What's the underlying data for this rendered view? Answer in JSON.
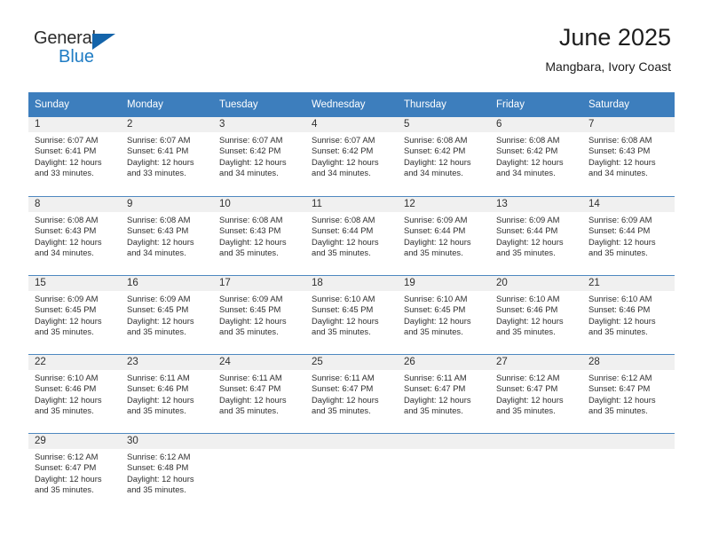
{
  "brand": {
    "name_top": "General",
    "name_bottom": "Blue",
    "triangle_icon": "blue-triangle-logo-mark",
    "colors": {
      "general_text": "#2b2b2b",
      "blue_text": "#1f7cc4",
      "triangle": "#1464aa"
    }
  },
  "header": {
    "title": "June 2025",
    "subtitle": "Mangbara, Ivory Coast"
  },
  "theme": {
    "header_row_bg": "#3d7ebd",
    "header_row_text": "#ffffff",
    "row_rule": "#4e88c0",
    "daynum_strip_bg": "#f0f0f0",
    "body_text": "#2f2f2f"
  },
  "calendar": {
    "weekday_headers": [
      "Sunday",
      "Monday",
      "Tuesday",
      "Wednesday",
      "Thursday",
      "Friday",
      "Saturday"
    ],
    "weeks": [
      [
        {
          "day": "1",
          "sunrise": "Sunrise: 6:07 AM",
          "sunset": "Sunset: 6:41 PM",
          "daylight_line1": "Daylight: 12 hours",
          "daylight_line2": "and 33 minutes."
        },
        {
          "day": "2",
          "sunrise": "Sunrise: 6:07 AM",
          "sunset": "Sunset: 6:41 PM",
          "daylight_line1": "Daylight: 12 hours",
          "daylight_line2": "and 33 minutes."
        },
        {
          "day": "3",
          "sunrise": "Sunrise: 6:07 AM",
          "sunset": "Sunset: 6:42 PM",
          "daylight_line1": "Daylight: 12 hours",
          "daylight_line2": "and 34 minutes."
        },
        {
          "day": "4",
          "sunrise": "Sunrise: 6:07 AM",
          "sunset": "Sunset: 6:42 PM",
          "daylight_line1": "Daylight: 12 hours",
          "daylight_line2": "and 34 minutes."
        },
        {
          "day": "5",
          "sunrise": "Sunrise: 6:08 AM",
          "sunset": "Sunset: 6:42 PM",
          "daylight_line1": "Daylight: 12 hours",
          "daylight_line2": "and 34 minutes."
        },
        {
          "day": "6",
          "sunrise": "Sunrise: 6:08 AM",
          "sunset": "Sunset: 6:42 PM",
          "daylight_line1": "Daylight: 12 hours",
          "daylight_line2": "and 34 minutes."
        },
        {
          "day": "7",
          "sunrise": "Sunrise: 6:08 AM",
          "sunset": "Sunset: 6:43 PM",
          "daylight_line1": "Daylight: 12 hours",
          "daylight_line2": "and 34 minutes."
        }
      ],
      [
        {
          "day": "8",
          "sunrise": "Sunrise: 6:08 AM",
          "sunset": "Sunset: 6:43 PM",
          "daylight_line1": "Daylight: 12 hours",
          "daylight_line2": "and 34 minutes."
        },
        {
          "day": "9",
          "sunrise": "Sunrise: 6:08 AM",
          "sunset": "Sunset: 6:43 PM",
          "daylight_line1": "Daylight: 12 hours",
          "daylight_line2": "and 34 minutes."
        },
        {
          "day": "10",
          "sunrise": "Sunrise: 6:08 AM",
          "sunset": "Sunset: 6:43 PM",
          "daylight_line1": "Daylight: 12 hours",
          "daylight_line2": "and 35 minutes."
        },
        {
          "day": "11",
          "sunrise": "Sunrise: 6:08 AM",
          "sunset": "Sunset: 6:44 PM",
          "daylight_line1": "Daylight: 12 hours",
          "daylight_line2": "and 35 minutes."
        },
        {
          "day": "12",
          "sunrise": "Sunrise: 6:09 AM",
          "sunset": "Sunset: 6:44 PM",
          "daylight_line1": "Daylight: 12 hours",
          "daylight_line2": "and 35 minutes."
        },
        {
          "day": "13",
          "sunrise": "Sunrise: 6:09 AM",
          "sunset": "Sunset: 6:44 PM",
          "daylight_line1": "Daylight: 12 hours",
          "daylight_line2": "and 35 minutes."
        },
        {
          "day": "14",
          "sunrise": "Sunrise: 6:09 AM",
          "sunset": "Sunset: 6:44 PM",
          "daylight_line1": "Daylight: 12 hours",
          "daylight_line2": "and 35 minutes."
        }
      ],
      [
        {
          "day": "15",
          "sunrise": "Sunrise: 6:09 AM",
          "sunset": "Sunset: 6:45 PM",
          "daylight_line1": "Daylight: 12 hours",
          "daylight_line2": "and 35 minutes."
        },
        {
          "day": "16",
          "sunrise": "Sunrise: 6:09 AM",
          "sunset": "Sunset: 6:45 PM",
          "daylight_line1": "Daylight: 12 hours",
          "daylight_line2": "and 35 minutes."
        },
        {
          "day": "17",
          "sunrise": "Sunrise: 6:09 AM",
          "sunset": "Sunset: 6:45 PM",
          "daylight_line1": "Daylight: 12 hours",
          "daylight_line2": "and 35 minutes."
        },
        {
          "day": "18",
          "sunrise": "Sunrise: 6:10 AM",
          "sunset": "Sunset: 6:45 PM",
          "daylight_line1": "Daylight: 12 hours",
          "daylight_line2": "and 35 minutes."
        },
        {
          "day": "19",
          "sunrise": "Sunrise: 6:10 AM",
          "sunset": "Sunset: 6:45 PM",
          "daylight_line1": "Daylight: 12 hours",
          "daylight_line2": "and 35 minutes."
        },
        {
          "day": "20",
          "sunrise": "Sunrise: 6:10 AM",
          "sunset": "Sunset: 6:46 PM",
          "daylight_line1": "Daylight: 12 hours",
          "daylight_line2": "and 35 minutes."
        },
        {
          "day": "21",
          "sunrise": "Sunrise: 6:10 AM",
          "sunset": "Sunset: 6:46 PM",
          "daylight_line1": "Daylight: 12 hours",
          "daylight_line2": "and 35 minutes."
        }
      ],
      [
        {
          "day": "22",
          "sunrise": "Sunrise: 6:10 AM",
          "sunset": "Sunset: 6:46 PM",
          "daylight_line1": "Daylight: 12 hours",
          "daylight_line2": "and 35 minutes."
        },
        {
          "day": "23",
          "sunrise": "Sunrise: 6:11 AM",
          "sunset": "Sunset: 6:46 PM",
          "daylight_line1": "Daylight: 12 hours",
          "daylight_line2": "and 35 minutes."
        },
        {
          "day": "24",
          "sunrise": "Sunrise: 6:11 AM",
          "sunset": "Sunset: 6:47 PM",
          "daylight_line1": "Daylight: 12 hours",
          "daylight_line2": "and 35 minutes."
        },
        {
          "day": "25",
          "sunrise": "Sunrise: 6:11 AM",
          "sunset": "Sunset: 6:47 PM",
          "daylight_line1": "Daylight: 12 hours",
          "daylight_line2": "and 35 minutes."
        },
        {
          "day": "26",
          "sunrise": "Sunrise: 6:11 AM",
          "sunset": "Sunset: 6:47 PM",
          "daylight_line1": "Daylight: 12 hours",
          "daylight_line2": "and 35 minutes."
        },
        {
          "day": "27",
          "sunrise": "Sunrise: 6:12 AM",
          "sunset": "Sunset: 6:47 PM",
          "daylight_line1": "Daylight: 12 hours",
          "daylight_line2": "and 35 minutes."
        },
        {
          "day": "28",
          "sunrise": "Sunrise: 6:12 AM",
          "sunset": "Sunset: 6:47 PM",
          "daylight_line1": "Daylight: 12 hours",
          "daylight_line2": "and 35 minutes."
        }
      ],
      [
        {
          "day": "29",
          "sunrise": "Sunrise: 6:12 AM",
          "sunset": "Sunset: 6:47 PM",
          "daylight_line1": "Daylight: 12 hours",
          "daylight_line2": "and 35 minutes."
        },
        {
          "day": "30",
          "sunrise": "Sunrise: 6:12 AM",
          "sunset": "Sunset: 6:48 PM",
          "daylight_line1": "Daylight: 12 hours",
          "daylight_line2": "and 35 minutes."
        },
        {
          "day": "",
          "sunrise": "",
          "sunset": "",
          "daylight_line1": "",
          "daylight_line2": ""
        },
        {
          "day": "",
          "sunrise": "",
          "sunset": "",
          "daylight_line1": "",
          "daylight_line2": ""
        },
        {
          "day": "",
          "sunrise": "",
          "sunset": "",
          "daylight_line1": "",
          "daylight_line2": ""
        },
        {
          "day": "",
          "sunrise": "",
          "sunset": "",
          "daylight_line1": "",
          "daylight_line2": ""
        },
        {
          "day": "",
          "sunrise": "",
          "sunset": "",
          "daylight_line1": "",
          "daylight_line2": ""
        }
      ]
    ]
  }
}
